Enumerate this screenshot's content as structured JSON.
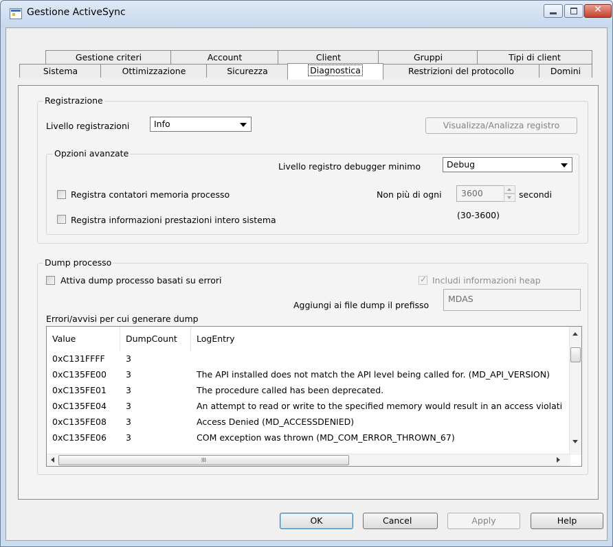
{
  "window": {
    "title": "Gestione ActiveSync"
  },
  "tabs_row1": [
    {
      "label": "Gestione criteri"
    },
    {
      "label": "Account"
    },
    {
      "label": "Client"
    },
    {
      "label": "Gruppi"
    },
    {
      "label": "Tipi di client"
    }
  ],
  "tabs_row2": [
    {
      "label": "Sistema"
    },
    {
      "label": "Ottimizzazione"
    },
    {
      "label": "Sicurezza"
    },
    {
      "label": "Diagnostica",
      "active": true
    },
    {
      "label": "Restrizioni del protocollo"
    },
    {
      "label": "Domini"
    }
  ],
  "registrazione": {
    "title": "Registrazione",
    "livello_label": "Livello registrazioni",
    "livello_value": "Info",
    "view_button": "Visualizza/Analizza registro",
    "avanzate": {
      "title": "Opzioni avanzate",
      "debugger_label": "Livello registro debugger minimo",
      "debugger_value": "Debug",
      "cb_memoria": "Registra contatori memoria processo",
      "cb_prestazioni": "Registra informazioni prestazioni intero sistema",
      "non_piu_label": "Non più di ogni",
      "seconds_value": "3600",
      "seconds_unit": "secondi",
      "range_hint": "(30-3600)"
    }
  },
  "dump": {
    "title": "Dump processo",
    "cb_attiva": "Attiva dump processo basati su errori",
    "cb_heap": "Includi informazioni heap",
    "prefix_label": "Aggiungi ai file dump il prefisso",
    "prefix_value": "MDAS",
    "list_label": "Errori/avvisi per cui generare dump",
    "columns": [
      "Value",
      "DumpCount",
      "LogEntry"
    ],
    "rows": [
      {
        "value": "0xC131FFFF",
        "count": "3",
        "entry": ""
      },
      {
        "value": "0xC135FE00",
        "count": "3",
        "entry": "The API installed does not match the API level being called for. (MD_API_VERSION)"
      },
      {
        "value": "0xC135FE01",
        "count": "3",
        "entry": "The procedure called has been deprecated."
      },
      {
        "value": "0xC135FE04",
        "count": "3",
        "entry": "An attempt to read or write to the specified memory would result in an access violation"
      },
      {
        "value": "0xC135FE08",
        "count": "3",
        "entry": "Access Denied (MD_ACCESSDENIED)"
      },
      {
        "value": "0xC135FE06",
        "count": "3",
        "entry": "COM exception was thrown (MD_COM_ERROR_THROWN_67)"
      }
    ],
    "hscroll_grip": "III"
  },
  "buttons": {
    "ok": "OK",
    "cancel": "Cancel",
    "apply": "Apply",
    "help": "Help"
  }
}
